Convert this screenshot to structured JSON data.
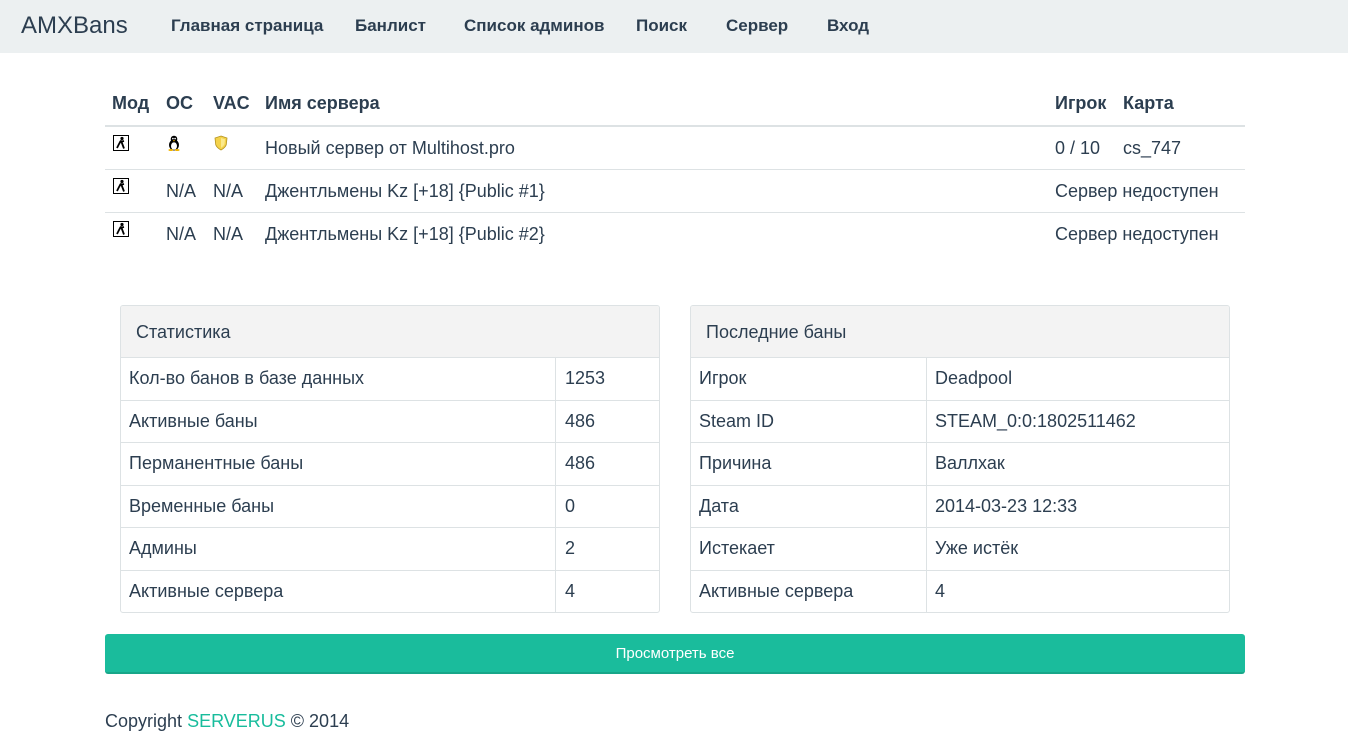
{
  "navbar": {
    "brand": "AMXBans",
    "items": [
      "Главная страница",
      "Банлист",
      "Список админов",
      "Поиск",
      "Сервер",
      "Вход"
    ]
  },
  "servers": {
    "headers": {
      "mod": "Мод",
      "os": "ОС",
      "vac": "VAC",
      "name": "Имя сервера",
      "player": "Игрок",
      "map": "Карта"
    },
    "rows": [
      {
        "mod_icon": "cstrike-icon",
        "os": "",
        "os_icon": "linux-tux-icon",
        "vac": "",
        "vac_icon": "vac-shield-icon",
        "name": "Новый сервер от Multihost.pro",
        "players": "0 / 10",
        "map": "cs_747"
      },
      {
        "mod_icon": "cstrike-icon",
        "os": "N/A",
        "vac": "N/A",
        "name": "Джентльмены Kz [+18] {Public #1}",
        "status": "Сервер недоступен"
      },
      {
        "mod_icon": "cstrike-icon",
        "os": "N/A",
        "vac": "N/A",
        "name": "Джентльмены Kz [+18] {Public #2}",
        "status": "Сервер недоступен"
      }
    ]
  },
  "stats": {
    "title": "Статистика",
    "rows": [
      {
        "label": "Кол-во банов в базе данных",
        "value": "1253"
      },
      {
        "label": "Активные баны",
        "value": "486"
      },
      {
        "label": "Перманентные баны",
        "value": "486"
      },
      {
        "label": "Временные баны",
        "value": "0"
      },
      {
        "label": "Админы",
        "value": "2"
      },
      {
        "label": "Активные сервера",
        "value": "4"
      }
    ]
  },
  "last_bans": {
    "title": "Последние баны",
    "rows": [
      {
        "label": "Игрок",
        "value": "Deadpool"
      },
      {
        "label": "Steam ID",
        "value": "STEAM_0:0:1802511462"
      },
      {
        "label": "Причина",
        "value": "Валлхак"
      },
      {
        "label": "Дата",
        "value": "2014-03-23 12:33"
      },
      {
        "label": "Истекает",
        "value": "Уже истёк"
      },
      {
        "label": "Активные сервера",
        "value": "4"
      }
    ]
  },
  "view_all_label": "Просмотреть все",
  "footer": {
    "prefix": "Copyright",
    "link": "SERVERUS",
    "suffix": "© 2014"
  },
  "colors": {
    "navbar_bg": "#ecf0f1",
    "text": "#2c3e50",
    "accent": "#1abc9c",
    "border": "#dde2e4"
  }
}
